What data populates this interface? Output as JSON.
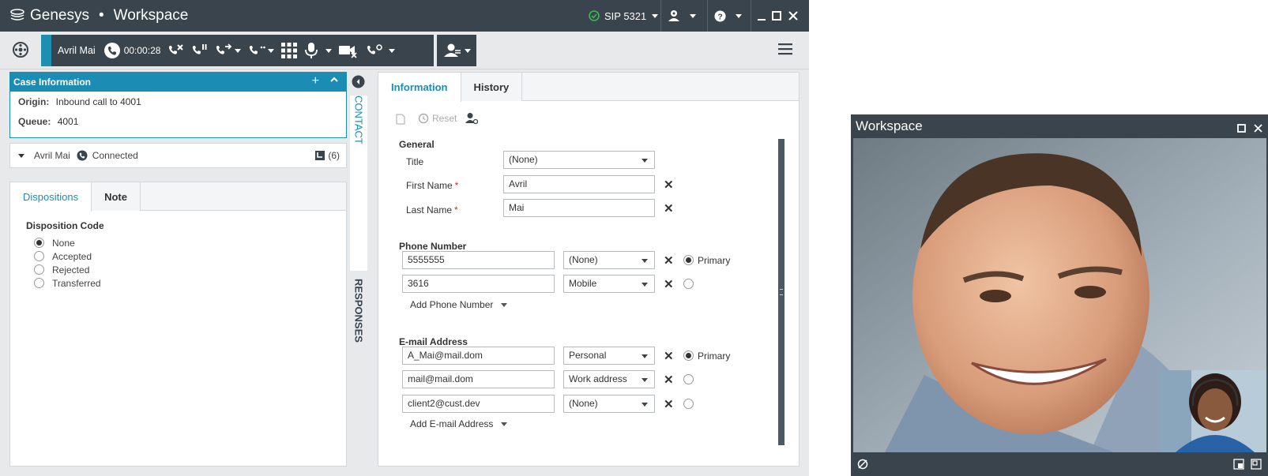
{
  "titlebar": {
    "brand": "Genesys",
    "separator": "•",
    "product": "Workspace",
    "sip_status": "SIP 5321",
    "status_color": "#3cba54"
  },
  "callbar": {
    "party_name": "Avril Mai",
    "timer": "00:00:28"
  },
  "case_info": {
    "title": "Case Information",
    "origin_label": "Origin:",
    "origin_value": "Inbound call to 4001",
    "queue_label": "Queue:",
    "queue_value": "4001"
  },
  "party": {
    "name": "Avril Mai",
    "state": "Connected",
    "count": "(6)"
  },
  "dispositions": {
    "tabs": [
      "Dispositions",
      "Note"
    ],
    "heading": "Disposition Code",
    "options": [
      "None",
      "Accepted",
      "Rejected",
      "Transferred"
    ],
    "selected": "None"
  },
  "side_strip": {
    "contact": "CONTACT",
    "responses": "RESPONSES"
  },
  "contact": {
    "tabs": [
      "Information",
      "History"
    ],
    "reset_label": "Reset",
    "general_label": "General",
    "title_label": "Title",
    "title_value": "(None)",
    "first_name_label": "First Name",
    "first_name_value": "Avril",
    "last_name_label": "Last Name",
    "last_name_value": "Mai",
    "phone_label": "Phone Number",
    "phones": [
      {
        "number": "5555555",
        "type": "(None)",
        "primary": true
      },
      {
        "number": "3616",
        "type": "Mobile",
        "primary": false
      }
    ],
    "add_phone_label": "Add Phone Number",
    "email_label": "E-mail Address",
    "emails": [
      {
        "address": "A_Mai@mail.dom",
        "type": "Personal",
        "primary": true
      },
      {
        "address": "mail@mail.dom",
        "type": "Work address",
        "primary": false
      },
      {
        "address": "client2@cust.dev",
        "type": "(None)",
        "primary": false
      }
    ],
    "primary_label": "Primary",
    "add_email_label": "Add E-mail Address"
  },
  "video_window": {
    "title": "Workspace"
  }
}
